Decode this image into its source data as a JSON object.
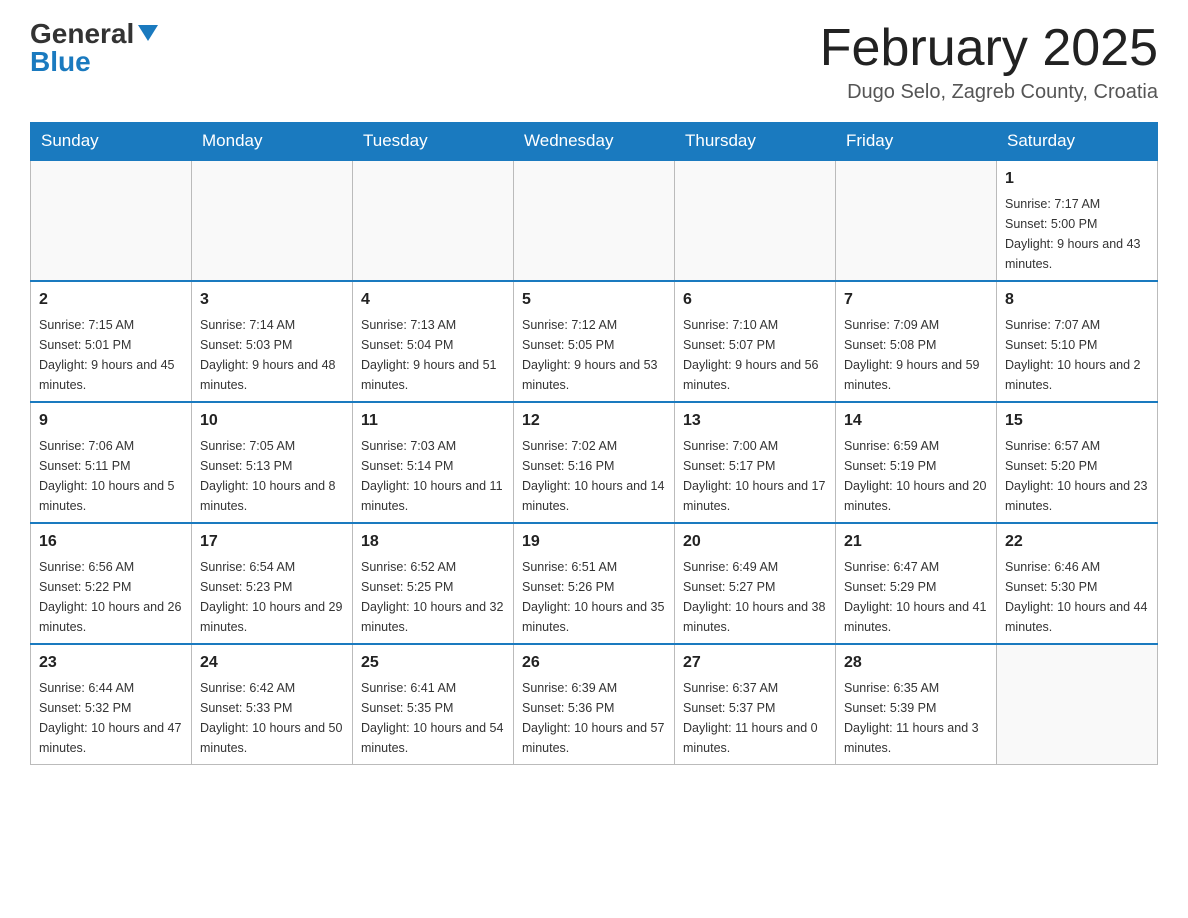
{
  "header": {
    "logo_general": "General",
    "logo_blue": "Blue",
    "month_title": "February 2025",
    "location": "Dugo Selo, Zagreb County, Croatia"
  },
  "days_of_week": [
    "Sunday",
    "Monday",
    "Tuesday",
    "Wednesday",
    "Thursday",
    "Friday",
    "Saturday"
  ],
  "weeks": [
    [
      {
        "day": "",
        "sunrise": "",
        "sunset": "",
        "daylight": ""
      },
      {
        "day": "",
        "sunrise": "",
        "sunset": "",
        "daylight": ""
      },
      {
        "day": "",
        "sunrise": "",
        "sunset": "",
        "daylight": ""
      },
      {
        "day": "",
        "sunrise": "",
        "sunset": "",
        "daylight": ""
      },
      {
        "day": "",
        "sunrise": "",
        "sunset": "",
        "daylight": ""
      },
      {
        "day": "",
        "sunrise": "",
        "sunset": "",
        "daylight": ""
      },
      {
        "day": "1",
        "sunrise": "Sunrise: 7:17 AM",
        "sunset": "Sunset: 5:00 PM",
        "daylight": "Daylight: 9 hours and 43 minutes."
      }
    ],
    [
      {
        "day": "2",
        "sunrise": "Sunrise: 7:15 AM",
        "sunset": "Sunset: 5:01 PM",
        "daylight": "Daylight: 9 hours and 45 minutes."
      },
      {
        "day": "3",
        "sunrise": "Sunrise: 7:14 AM",
        "sunset": "Sunset: 5:03 PM",
        "daylight": "Daylight: 9 hours and 48 minutes."
      },
      {
        "day": "4",
        "sunrise": "Sunrise: 7:13 AM",
        "sunset": "Sunset: 5:04 PM",
        "daylight": "Daylight: 9 hours and 51 minutes."
      },
      {
        "day": "5",
        "sunrise": "Sunrise: 7:12 AM",
        "sunset": "Sunset: 5:05 PM",
        "daylight": "Daylight: 9 hours and 53 minutes."
      },
      {
        "day": "6",
        "sunrise": "Sunrise: 7:10 AM",
        "sunset": "Sunset: 5:07 PM",
        "daylight": "Daylight: 9 hours and 56 minutes."
      },
      {
        "day": "7",
        "sunrise": "Sunrise: 7:09 AM",
        "sunset": "Sunset: 5:08 PM",
        "daylight": "Daylight: 9 hours and 59 minutes."
      },
      {
        "day": "8",
        "sunrise": "Sunrise: 7:07 AM",
        "sunset": "Sunset: 5:10 PM",
        "daylight": "Daylight: 10 hours and 2 minutes."
      }
    ],
    [
      {
        "day": "9",
        "sunrise": "Sunrise: 7:06 AM",
        "sunset": "Sunset: 5:11 PM",
        "daylight": "Daylight: 10 hours and 5 minutes."
      },
      {
        "day": "10",
        "sunrise": "Sunrise: 7:05 AM",
        "sunset": "Sunset: 5:13 PM",
        "daylight": "Daylight: 10 hours and 8 minutes."
      },
      {
        "day": "11",
        "sunrise": "Sunrise: 7:03 AM",
        "sunset": "Sunset: 5:14 PM",
        "daylight": "Daylight: 10 hours and 11 minutes."
      },
      {
        "day": "12",
        "sunrise": "Sunrise: 7:02 AM",
        "sunset": "Sunset: 5:16 PM",
        "daylight": "Daylight: 10 hours and 14 minutes."
      },
      {
        "day": "13",
        "sunrise": "Sunrise: 7:00 AM",
        "sunset": "Sunset: 5:17 PM",
        "daylight": "Daylight: 10 hours and 17 minutes."
      },
      {
        "day": "14",
        "sunrise": "Sunrise: 6:59 AM",
        "sunset": "Sunset: 5:19 PM",
        "daylight": "Daylight: 10 hours and 20 minutes."
      },
      {
        "day": "15",
        "sunrise": "Sunrise: 6:57 AM",
        "sunset": "Sunset: 5:20 PM",
        "daylight": "Daylight: 10 hours and 23 minutes."
      }
    ],
    [
      {
        "day": "16",
        "sunrise": "Sunrise: 6:56 AM",
        "sunset": "Sunset: 5:22 PM",
        "daylight": "Daylight: 10 hours and 26 minutes."
      },
      {
        "day": "17",
        "sunrise": "Sunrise: 6:54 AM",
        "sunset": "Sunset: 5:23 PM",
        "daylight": "Daylight: 10 hours and 29 minutes."
      },
      {
        "day": "18",
        "sunrise": "Sunrise: 6:52 AM",
        "sunset": "Sunset: 5:25 PM",
        "daylight": "Daylight: 10 hours and 32 minutes."
      },
      {
        "day": "19",
        "sunrise": "Sunrise: 6:51 AM",
        "sunset": "Sunset: 5:26 PM",
        "daylight": "Daylight: 10 hours and 35 minutes."
      },
      {
        "day": "20",
        "sunrise": "Sunrise: 6:49 AM",
        "sunset": "Sunset: 5:27 PM",
        "daylight": "Daylight: 10 hours and 38 minutes."
      },
      {
        "day": "21",
        "sunrise": "Sunrise: 6:47 AM",
        "sunset": "Sunset: 5:29 PM",
        "daylight": "Daylight: 10 hours and 41 minutes."
      },
      {
        "day": "22",
        "sunrise": "Sunrise: 6:46 AM",
        "sunset": "Sunset: 5:30 PM",
        "daylight": "Daylight: 10 hours and 44 minutes."
      }
    ],
    [
      {
        "day": "23",
        "sunrise": "Sunrise: 6:44 AM",
        "sunset": "Sunset: 5:32 PM",
        "daylight": "Daylight: 10 hours and 47 minutes."
      },
      {
        "day": "24",
        "sunrise": "Sunrise: 6:42 AM",
        "sunset": "Sunset: 5:33 PM",
        "daylight": "Daylight: 10 hours and 50 minutes."
      },
      {
        "day": "25",
        "sunrise": "Sunrise: 6:41 AM",
        "sunset": "Sunset: 5:35 PM",
        "daylight": "Daylight: 10 hours and 54 minutes."
      },
      {
        "day": "26",
        "sunrise": "Sunrise: 6:39 AM",
        "sunset": "Sunset: 5:36 PM",
        "daylight": "Daylight: 10 hours and 57 minutes."
      },
      {
        "day": "27",
        "sunrise": "Sunrise: 6:37 AM",
        "sunset": "Sunset: 5:37 PM",
        "daylight": "Daylight: 11 hours and 0 minutes."
      },
      {
        "day": "28",
        "sunrise": "Sunrise: 6:35 AM",
        "sunset": "Sunset: 5:39 PM",
        "daylight": "Daylight: 11 hours and 3 minutes."
      },
      {
        "day": "",
        "sunrise": "",
        "sunset": "",
        "daylight": ""
      }
    ]
  ]
}
